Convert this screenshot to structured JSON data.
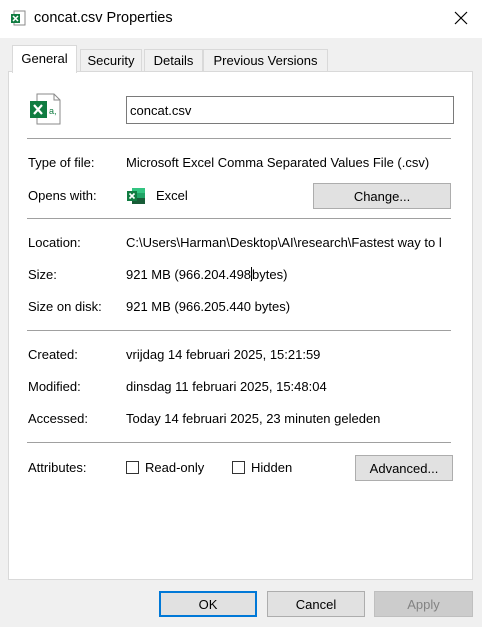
{
  "window": {
    "title": "concat.csv Properties",
    "title_icon": "excel-csv-file-icon",
    "close_icon": "close-icon"
  },
  "tabs": [
    {
      "label": "General",
      "active": true
    },
    {
      "label": "Security",
      "active": false
    },
    {
      "label": "Details",
      "active": false
    },
    {
      "label": "Previous Versions",
      "active": false
    }
  ],
  "general": {
    "file_name": "concat.csv",
    "file_icon": "excel-csv-file-icon",
    "type_label": "Type of file:",
    "type_value": "Microsoft Excel Comma Separated Values File (.csv)",
    "opens_label": "Opens with:",
    "opens_icon": "excel-app-icon",
    "opens_value": "Excel",
    "change_button": "Change...",
    "location_label": "Location:",
    "location_value": "C:\\Users\\Harman\\Desktop\\AI\\research\\Fastest way to l",
    "size_label": "Size:",
    "size_value_a": "921 MB (966.204.498",
    "size_value_b": "bytes)",
    "size_disk_label": "Size on disk:",
    "size_disk_value": "921 MB (966.205.440 bytes)",
    "created_label": "Created:",
    "created_value": "vrijdag 14 februari 2025, 15:21:59",
    "modified_label": "Modified:",
    "modified_value": "dinsdag 11 februari 2025, 15:48:04",
    "accessed_label": "Accessed:",
    "accessed_value": "Today 14 februari 2025, 23 minuten geleden",
    "attributes_label": "Attributes:",
    "readonly_label": "Read-only",
    "readonly_checked": false,
    "hidden_label": "Hidden",
    "hidden_checked": false,
    "advanced_button": "Advanced..."
  },
  "footer": {
    "ok": "OK",
    "cancel": "Cancel",
    "apply": "Apply"
  },
  "colors": {
    "excel_green": "#107c41",
    "focus_blue": "#0078d7"
  }
}
